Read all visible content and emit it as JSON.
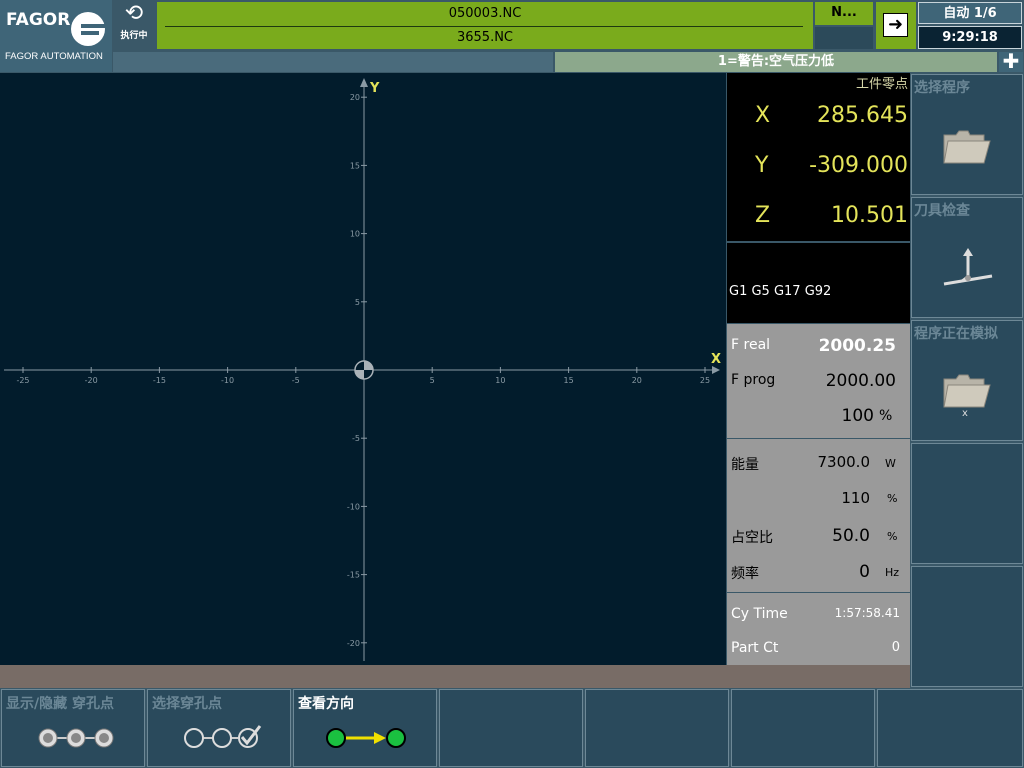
{
  "header": {
    "brand": "FAGOR",
    "brand_sub": "FAGOR AUTOMATION",
    "run_status": "执行中",
    "program_line1": "050003.NC",
    "program_line2": "3655.NC",
    "n_label": "N...",
    "mode": "自动 1/6",
    "time": "9:29:18"
  },
  "message": {
    "text": "1=警告:空气压力低"
  },
  "graph": {
    "x_label": "X",
    "y_label": "Y",
    "x_ticks": [
      "-25",
      "-20",
      "-15",
      "-10",
      "-5",
      "5",
      "10",
      "15",
      "20",
      "25"
    ],
    "y_ticks": [
      "20",
      "15",
      "10",
      "5",
      "-5",
      "-10",
      "-15",
      "-20"
    ]
  },
  "position": {
    "title": "工件零点",
    "axes": [
      {
        "name": "X",
        "value": "285.645"
      },
      {
        "name": "Y",
        "value": "-309.000"
      },
      {
        "name": "Z",
        "value": "10.501"
      }
    ]
  },
  "gcodes": "G1 G5 G17 G92",
  "feed": {
    "f_real_label": "F real",
    "f_real_value": "2000.25",
    "f_prog_label": "F prog",
    "f_prog_value": "2000.00",
    "override_value": "100",
    "override_unit": "%"
  },
  "power": {
    "energy_label": "能量",
    "energy_value": "7300.0",
    "energy_unit": "W",
    "percent_value": "110",
    "percent_unit": "%",
    "duty_label": "占空比",
    "duty_value": "50.0",
    "duty_unit": "%",
    "freq_label": "频率",
    "freq_value": "0",
    "freq_unit": "Hz"
  },
  "cycle": {
    "cy_time_label": "Cy Time",
    "cy_time_value": "1:57:58.41",
    "part_ct_label": "Part Ct",
    "part_ct_value": "0"
  },
  "side_buttons": [
    {
      "label": "选择程序",
      "icon": "folder-icon"
    },
    {
      "label": "刀具检查",
      "icon": "tool-axes-icon"
    },
    {
      "label": "程序正在模拟",
      "icon": "folder-simulate-icon"
    },
    {
      "label": "",
      "icon": ""
    },
    {
      "label": "",
      "icon": ""
    }
  ],
  "bottom_buttons": [
    {
      "label": "显示/隐藏 穿孔点",
      "icon": "three-circles-icon"
    },
    {
      "label": "选择穿孔点",
      "icon": "circles-check-icon"
    },
    {
      "label": "查看方向",
      "icon": "direction-arrow-icon"
    },
    {
      "label": ""
    },
    {
      "label": ""
    },
    {
      "label": ""
    }
  ],
  "colors": {
    "program_bg": "#7aab1c",
    "graph_bg": "#021c2c",
    "position_text": "#e4e45a",
    "message_bg": "#8ca88c"
  }
}
